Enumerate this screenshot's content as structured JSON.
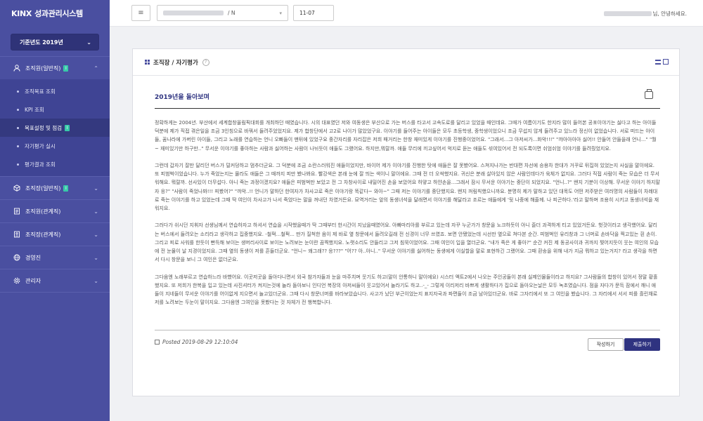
{
  "app": {
    "logo_brand": "KINX",
    "logo_name": "성과관리시스템"
  },
  "sidebar": {
    "year_select": "기준년도 2019년",
    "menu": [
      {
        "label": "조직원(일반직)",
        "badge": "I",
        "expanded": true
      },
      {
        "label": "조직장(일반직)",
        "badge": "I",
        "expanded": false
      },
      {
        "label": "조직원(관계직)",
        "badge": "",
        "expanded": false
      },
      {
        "label": "조직장(관계직)",
        "badge": "",
        "expanded": false
      },
      {
        "label": "경영진",
        "badge": "",
        "expanded": false
      },
      {
        "label": "관리자",
        "badge": "",
        "expanded": false
      }
    ],
    "submenu": [
      {
        "label": "조직목표 조회"
      },
      {
        "label": "KPI 조회"
      },
      {
        "label": "목표설정 및 점검",
        "badge": "I",
        "active": true
      },
      {
        "label": "자기평가 실시"
      },
      {
        "label": "평가결과 조회"
      }
    ]
  },
  "topbar": {
    "select_suffix": "/  N",
    "date_value": "11-07",
    "greeting_suffix": "님, 안녕하세요."
  },
  "card": {
    "title": "조직장 / 자기평가",
    "help": "?"
  },
  "post": {
    "title": "2019년을 돌아보며",
    "paragraphs": [
      "정확하게는 2004년. 부산에서 세계합창올림픽대회를 개최하던 때였습니다. 시의 대표였던 저와 여동생은 부산으로 가는 버스를 타고서 고속도로를 달리고 있었을 때인데요. 그때가 여름이기도 한지라 많이 들어본 공포이야기는 싫다고 하는 아이들 덕분에 제가 직접 겪은일을 조금 3인칭으로 바꿔서 들려주었었지요. 제가 합창단에서 고2로 나이가 많았었구요. 이야기를 들어주는 아이들은 모두 초등학생, 중학생이었으니 조금 무섭지 않게 들려주고 있느라 정신이 없었습니다. 서로 떠드는 아이들, 꿈나라에 가버린 아이들, 그리고 노래를 연습하는 언니 오빠들이 맨뒤에 있었구요 중간자리를 자리잡은 저희 패거리는 한창 재미있게 이야기를 진행중이었어요. \"그래서...그 아저씨가...화악!!!\" \"꺄아아아아 싫어!! 안들어 안들을래 언니...\" \"뭘~ 재미있기만 하구만..\" 무서운 이야기를 좋아하는 사람과 싫어하는 사람이 나뉘듯이 애들도 그랬어요. 하지만,뭐랄까. 애들 무리에 끼고싶어서 억지로 듣는 애들도 섞여있어서 전 되도록이면 쉬엄쉬엄 이야기를 들려줬었지요.",
      "그런데 갑자기 잘만 달리던 버스가 덜커덩하고 멈추더군요. 그 덕분에 조금 소란스러워진 애들이었지만, 바이어 제가 이야기를 진행한 탓에 애들은 잘 못봤어요. 스쳐지나가는 반대편 차선에 승용차 한대가 거꾸로 뒤집혀 있었는지 사실을 말이에요. 또 피범벅이었습니다. 누가 죽었는지는 몰라도 애들은 그 때까지 피만 봤나봐요. 빨강색은 본래 눈에 잘 띄는 색이니 말이에요. 그때 전 더 오싹했지요. 귀신은 분래 살아있지 않은 사람인데다가 육체가 없지요. 그러다 직접 사람이 죽는 모습은 더 무서워해요. 뭐랄까. 선사있이 더무섭다. 아니 죽는 과정이겠지요? 애들은 피범벅만 보았고 전 그 차창사이로 내밀어진 손을 보았어요 하얗고 하얀손을...그래서 잠시 무서운 이야기는 중단이 되었지요. \"언니..?\" 왠지 기분이 이상해. 무서운 이야기 하지말자 응?\" \"사람이 죽었나봐!!! 피봤어?\" \"꺄악..!! 언니가 말하던 한여자가 차사고로 죽은 이야기랑 똑같다~ 와아~\" 그때 저는 이야기를 중단했지요. 왠지 꺼림칙했으니까요. 분명히 제가 말하고 있던 대목도 어떤 저주받은 여러명의 사람들이 차례대로 죽는 이야기를 하고 있었는데 그때 딱 여인이 차사고가 나서 죽었다는 말을 꺼내던 차였거든요. 묘역거리는 앞의 동생녀석을 달래면서 이야기를 해달라고 조르는 애들에게 '뒷 나중에 해줄께. 나 피곤하다.'라고 말하며 조용히 시키고 동생녀석을 재워지요.",
      "그러다가 쉬시던 지휘자 선생님께서 연습하자고 하셔서 연습을 시작했을때가 딱 그때부터 한시간이 지났을때였어요. 아빠마리아를 부르고 있는데 자꾸 누군가가 창문을 노크하듯이 아니 즐더 과격하게 티고 있었거든요. 헛것이라고 생각했어요. 달리는 버스에서 들려오는 소리라고 생각하고 집중했지요. -철퍽...철퍽... 딴가 질척한 음이 제 바로 옆 창문에서 들려오길래 전 신경이 너무 쓰였죠. 보면 안됐었는데 시선만 옆으로 쳐다본 순간. 피범벅인 유리창과 그 너머로 손바닥을 찍고있는 흰 손이. 그리고 피로 사워를 한듯이 빤득해 보이는 생머리사이로 보이는 노려보는 눈이란 끔찍했지요. 노랫소리도 안들리고 그저 침묵이었어요. 그때 여인이 입을 열더군요. \"내가 죽은 게 좋아?\" 순간 커진 제 동공사이과 귀까지 찢어지듯이 웃는 여인의 모습에 전 눈물이 날 지경이었지요. 그때 옆의 동생이 저를 흔들더군요. \"언니~ 왜그래?? 응???\" \"어?? 아..아니..\" 무서운 이야기를 싫어하는 동생에게 이실할을 말로 표현하긴 그랬어요. 그때 환송을 위해 내가 지금 뭐하고 있는거지? 라고 생각을 하면서 다시 창문을 보니 그 여인은 없더군요.",
      "그다음엔 노래부르고 연습하느라 바빴어요. 이곳저곳을 돌아다니면서 외국 참가자들과 눈을 마주치며 웃기도 하고(말이 안통하니 말이에요) 시스터 액트2에서 나오는 주인공들이 본래 실제인물들이라고 하지요? 그사람들의 합창이 있어서 정말 황홀했지요. 또 저희가 한복을 입고 있는데 사진셔터가 켜지는것에 놀라 돌아보니 인디언 복장의 아저씨들이 웃고있어서 놀라기도 하고..-_- 그렇게 이리저리 바쁘게 생활하다가 집으로 돌아오는날은 모두 녹초였습니다. 점을 자다가 문득 잠에서 깨니 애들이 지네들이 무서운 이야기를 어이없게 지으면서 놀고있더군요. 그때 다시 창문너머를 바라보았습니다. 사고가 났던 부근이었는지 표지자국과 파편들이 조금 남아있더군요. 바로 그자리에서 또 그 여인을 봤습니다. 그 자리에서 서서 피를 흘린채로 저를 노려보는 두눈이 말이지요. 그다음엔 그여인을 못봤다는 것 자체가 전 행복합니다."
    ],
    "posted_at": "Posted 2019-08-29 12:10:04"
  },
  "buttons": {
    "write": "작성하기",
    "submit": "제출하기"
  },
  "colors": {
    "sidebar": "#4a4fa0",
    "accent": "#2f3380",
    "badge": "#38c9a9"
  }
}
